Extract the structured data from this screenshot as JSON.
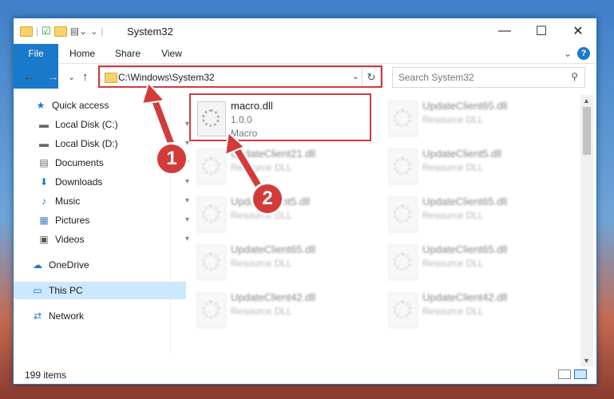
{
  "window": {
    "title": "System32",
    "controls": {
      "minimize": "—",
      "maximize": "☐",
      "close": "✕"
    }
  },
  "ribbon": {
    "tabs": [
      "File",
      "Home",
      "Share",
      "View"
    ],
    "collapse": "⌄",
    "help": "?"
  },
  "address": {
    "path": "C:\\Windows\\System32",
    "dropdown": "⌄",
    "refresh": "↻"
  },
  "nav": {
    "back": "←",
    "forward": "→",
    "recent": "⌄",
    "up": "↑"
  },
  "search": {
    "placeholder": "Search System32",
    "icon": "⚲"
  },
  "sidebar": {
    "items": [
      {
        "label": "Quick access",
        "icon": "star-icon",
        "glyph": "★",
        "pinned": false
      },
      {
        "label": "Local Disk (C:)",
        "icon": "disk-icon",
        "glyph": "▬",
        "pinned": true
      },
      {
        "label": "Local Disk (D:)",
        "icon": "disk-icon",
        "glyph": "▬",
        "pinned": true
      },
      {
        "label": "Documents",
        "icon": "documents-icon",
        "glyph": "▤",
        "pinned": true
      },
      {
        "label": "Downloads",
        "icon": "download-icon",
        "glyph": "⬇",
        "pinned": true
      },
      {
        "label": "Music",
        "icon": "music-icon",
        "glyph": "♪",
        "pinned": true
      },
      {
        "label": "Pictures",
        "icon": "pictures-icon",
        "glyph": "▦",
        "pinned": true
      },
      {
        "label": "Videos",
        "icon": "videos-icon",
        "glyph": "▣",
        "pinned": true
      },
      {
        "label": "OneDrive",
        "icon": "cloud-icon",
        "glyph": "☁",
        "pinned": false
      },
      {
        "label": "This PC",
        "icon": "computer-icon",
        "glyph": "▭",
        "pinned": false
      },
      {
        "label": "Network",
        "icon": "network-icon",
        "glyph": "⇄",
        "pinned": false
      }
    ],
    "pin_glyph": "📌"
  },
  "files": [
    {
      "name": "macro.dll",
      "line2": "1.0.0",
      "line3": "Macro",
      "highlighted": true
    },
    {
      "name": "UpdateClient65.dll",
      "line2": "Resource DLL",
      "line3": ""
    },
    {
      "name": "UpdateClient21.dll",
      "line2": "Resource DLL",
      "line3": ""
    },
    {
      "name": "UpdateClient5.dll",
      "line2": "Resource DLL",
      "line3": ""
    },
    {
      "name": "UpdateClient5.dll",
      "line2": "Resource DLL",
      "line3": ""
    },
    {
      "name": "UpdateClient65.dll",
      "line2": "Resource DLL",
      "line3": ""
    },
    {
      "name": "UpdateClient65.dll",
      "line2": "Resource DLL",
      "line3": ""
    },
    {
      "name": "UpdateClient65.dll",
      "line2": "Resource DLL",
      "line3": ""
    },
    {
      "name": "UpdateClient42.dll",
      "line2": "Resource DLL",
      "line3": ""
    },
    {
      "name": "UpdateClient42.dll",
      "line2": "Resource DLL",
      "line3": ""
    }
  ],
  "status": {
    "count": "199 items"
  },
  "annotations": {
    "step1": "1",
    "step2": "2"
  },
  "colors": {
    "accent": "#1979ca",
    "highlight": "#d33b3b",
    "selected": "#cce8ff"
  }
}
